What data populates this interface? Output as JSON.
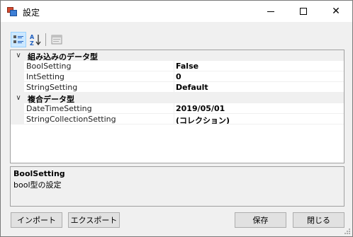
{
  "window": {
    "title": "設定"
  },
  "titlebar_buttons": {
    "close_glyph": "✕"
  },
  "toolbar": {
    "categorized_icon": "categorized-icon",
    "alphabetical_icon": "alphabetical-sort-icon",
    "property_pages_icon": "property-pages-icon"
  },
  "property_grid": {
    "categories": [
      {
        "label": "組み込みのデータ型",
        "properties": [
          {
            "name": "BoolSetting",
            "value": "False"
          },
          {
            "name": "IntSetting",
            "value": "0"
          },
          {
            "name": "StringSetting",
            "value": "Default"
          }
        ]
      },
      {
        "label": "複合データ型",
        "properties": [
          {
            "name": "DateTimeSetting",
            "value": "2019/05/01"
          },
          {
            "name": "StringCollectionSetting",
            "value": "(コレクション)"
          }
        ]
      }
    ]
  },
  "help": {
    "title": "BoolSetting",
    "description": "bool型の設定"
  },
  "buttons": {
    "import": "インポート",
    "export": "エクスポート",
    "save": "保存",
    "close": "閉じる"
  },
  "colors": {
    "selected_toolbar_bg": "#cce8ff",
    "window_bg": "#f0f0f0"
  }
}
